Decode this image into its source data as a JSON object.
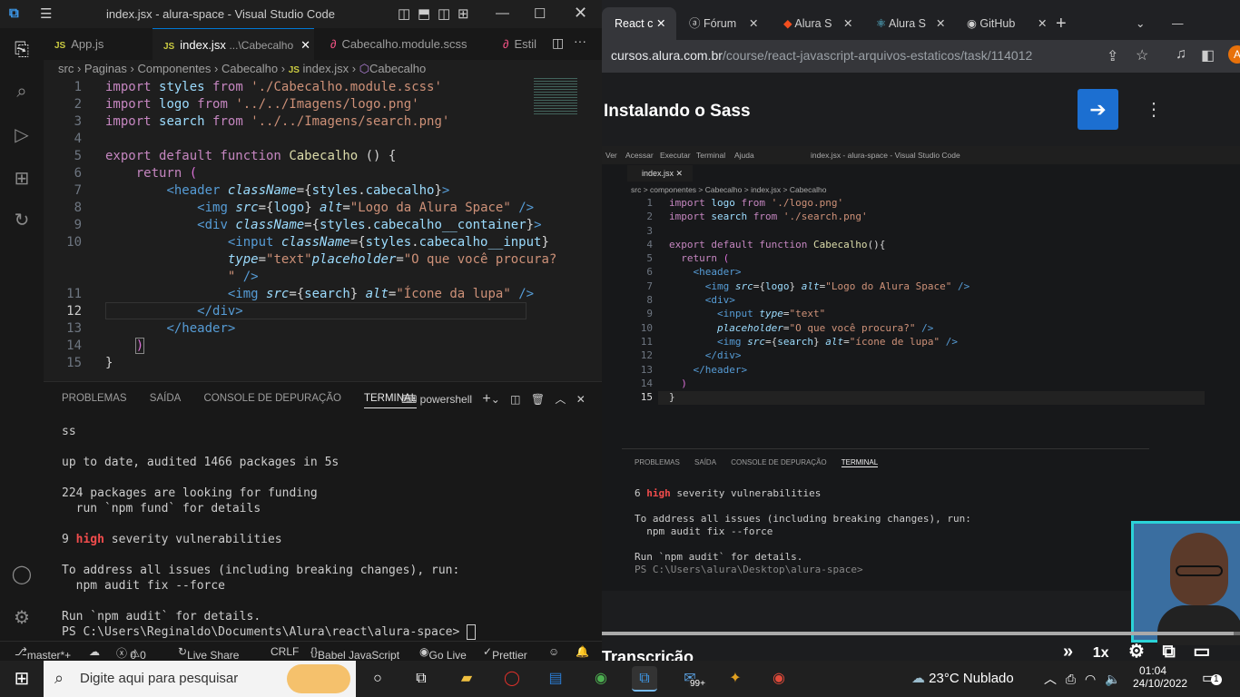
{
  "vscode": {
    "window_title": "index.jsx - alura-space - Visual Studio Code",
    "tabs": [
      {
        "label": "App.js",
        "type": "JS"
      },
      {
        "label": "index.jsx",
        "suffix": "...\\Cabecalho",
        "type": "JS",
        "active": true
      },
      {
        "label": "Cabecalho.module.scss",
        "type": "scss"
      },
      {
        "label": "Estil",
        "type": "scss"
      }
    ],
    "breadcrumb": [
      "src",
      "Paginas",
      "Componentes",
      "Cabecalho",
      "index.jsx",
      "Cabecalho"
    ],
    "line_numbers": [
      "1",
      "2",
      "3",
      "4",
      "5",
      "6",
      "7",
      "8",
      "9",
      "10",
      "11",
      "12",
      "13",
      "14",
      "15"
    ],
    "panel_tabs": [
      "PROBLEMAS",
      "SAÍDA",
      "CONSOLE DE DEPURAÇÃO",
      "TERMINAL"
    ],
    "shell": "powershell",
    "terminal": {
      "l1": "ss",
      "l2": "up to date, audited 1466 packages in 5s",
      "l3": "224 packages are looking for funding",
      "l4": "  run `npm fund` for details",
      "l5_count": "9",
      "l5_hi": "high",
      "l5_rest": "severity vulnerabilities",
      "l6": "To address all issues (including breaking changes), run:",
      "l7": "  npm audit fix --force",
      "l8": "Run `npm audit` for details.",
      "l9": "PS C:\\Users\\Reginaldo\\Documents\\Alura\\react\\alura-space> "
    },
    "status": {
      "branch": "master*+",
      "errors": "0",
      "warnings": "0",
      "live_share": "Live Share",
      "eol": "CRLF",
      "lang": "Babel JavaScript",
      "go_live": "Go Live",
      "prettier": "Prettier"
    }
  },
  "browser": {
    "tabs": [
      "React c",
      "Fórum",
      "Alura S",
      "Alura S",
      "GitHub"
    ],
    "url_host": "cursos.alura.com.br",
    "url_path": "/course/react-javascript-arquivos-estaticos/task/114012",
    "lesson_title": "Instalando o Sass",
    "video": {
      "menu": [
        "Ver",
        "Acessar",
        "Executar",
        "Terminal",
        "Ajuda"
      ],
      "title": "index.jsx - alura-space - Visual Studio Code",
      "tab": "index.jsx",
      "crumb": "src > componentes > Cabecalho > index.jsx > Cabecalho",
      "line_numbers": [
        "1",
        "2",
        "3",
        "4",
        "5",
        "6",
        "7",
        "8",
        "9",
        "10",
        "11",
        "12",
        "13",
        "14",
        "15"
      ],
      "panel_tabs": [
        "PROBLEMAS",
        "SAÍDA",
        "CONSOLE DE DEPURAÇÃO",
        "TERMINAL"
      ],
      "t1_count": "6",
      "t1_hi": "high",
      "t1_rest": "severity vulnerabilities",
      "t2": "To address all issues (including breaking changes), run:",
      "t3": "  npm audit fix --force",
      "t4": "Run `npm audit` for details.",
      "t5": "PS C:\\Users\\alura\\Desktop\\alura-space> ",
      "speed": "1x"
    },
    "section_below": "Transcrição"
  },
  "taskbar": {
    "search_placeholder": "Digite aqui para pesquisar",
    "weather": "23°C  Nublado",
    "time": "01:04",
    "date": "24/10/2022",
    "badge": "99+",
    "notif_count": "1"
  }
}
